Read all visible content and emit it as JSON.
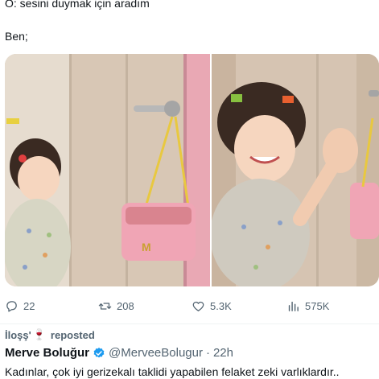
{
  "tweet": {
    "line1": "O: sesini duymak için aradım",
    "line2": "Ben;",
    "media": [
      {
        "icon": "photo-girl-phone"
      },
      {
        "icon": "photo-girl-waving"
      }
    ]
  },
  "actions": {
    "replies": "22",
    "reposts": "208",
    "likes": "5.3K",
    "views": "575K"
  },
  "repost_header": {
    "user": "İloşş'",
    "emoji": "🍷",
    "label": "reposted"
  },
  "next_post": {
    "author_name": "Merve Boluğur",
    "handle": "@MerveeBolugur",
    "separator": "·",
    "time": "22h",
    "text": "Kadınlar, çok iyi gerizekalı taklidi yapabilen felaket zeki varlıklardır.."
  },
  "colors": {
    "text_primary": "#0f1419",
    "text_secondary": "#536471",
    "verified": "#1d9bf0"
  }
}
